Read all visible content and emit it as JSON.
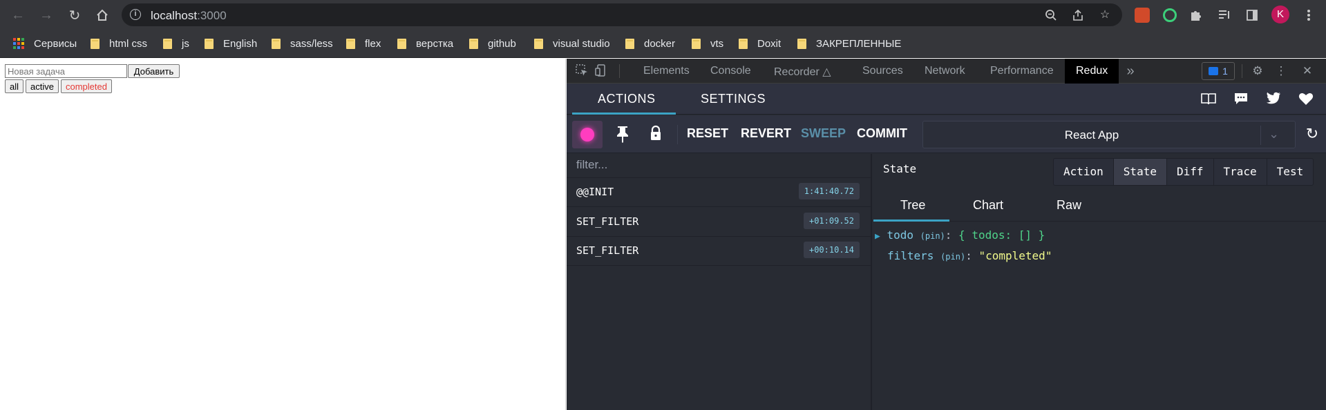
{
  "browser": {
    "url_host": "localhost",
    "url_port": ":3000",
    "profile_initial": "K",
    "bookmarks": [
      {
        "label": "Сервисы",
        "icon": "apps-grid-icon"
      },
      {
        "label": "html css",
        "icon": "folder-icon"
      },
      {
        "label": "js",
        "icon": "folder-icon"
      },
      {
        "label": "English",
        "icon": "folder-icon"
      },
      {
        "label": "sass/less",
        "icon": "folder-icon"
      },
      {
        "label": "flex",
        "icon": "folder-icon"
      },
      {
        "label": "верстка",
        "icon": "folder-icon"
      },
      {
        "label": "github",
        "icon": "folder-icon"
      },
      {
        "label": "visual studio",
        "icon": "folder-icon"
      },
      {
        "label": "docker",
        "icon": "folder-icon"
      },
      {
        "label": "vts",
        "icon": "folder-icon"
      },
      {
        "label": "Doxit",
        "icon": "folder-icon"
      },
      {
        "label": "ЗАКРЕПЛЕННЫЕ",
        "icon": "folder-icon"
      }
    ]
  },
  "app": {
    "input_placeholder": "Новая задача",
    "add_label": "Добавить",
    "filters": [
      {
        "label": "all"
      },
      {
        "label": "active"
      },
      {
        "label": "completed"
      }
    ],
    "selected_filter": "completed",
    "selected_color": "#e53935"
  },
  "devtools": {
    "tabs": [
      "Elements",
      "Console",
      "Recorder",
      "Sources",
      "Network",
      "Performance",
      "Redux"
    ],
    "selected_tab": "Redux",
    "issues_count": "1"
  },
  "redux": {
    "top_tabs": [
      "ACTIONS",
      "SETTINGS"
    ],
    "buttons": {
      "reset": "RESET",
      "revert": "REVERT",
      "sweep": "SWEEP",
      "commit": "COMMIT"
    },
    "instance": "React App",
    "filter_placeholder": "filter...",
    "actions": [
      {
        "name": "@@INIT",
        "time": "1:41:40.72"
      },
      {
        "name": "SET_FILTER",
        "time": "+01:09.52"
      },
      {
        "name": "SET_FILTER",
        "time": "+00:10.14"
      }
    ],
    "monitor_title": "State",
    "monitor_tabs": [
      "Action",
      "State",
      "Diff",
      "Trace",
      "Test"
    ],
    "monitor_selected": "State",
    "view_tabs": [
      "Tree",
      "Chart",
      "Raw"
    ],
    "view_selected": "Tree",
    "state_tree": {
      "todo_key": "todo",
      "todo_pin": "(pin)",
      "todo_value": "{ todos: [] }",
      "filters_key": "filters",
      "filters_pin": "(pin)",
      "filters_value": "\"completed\""
    }
  }
}
